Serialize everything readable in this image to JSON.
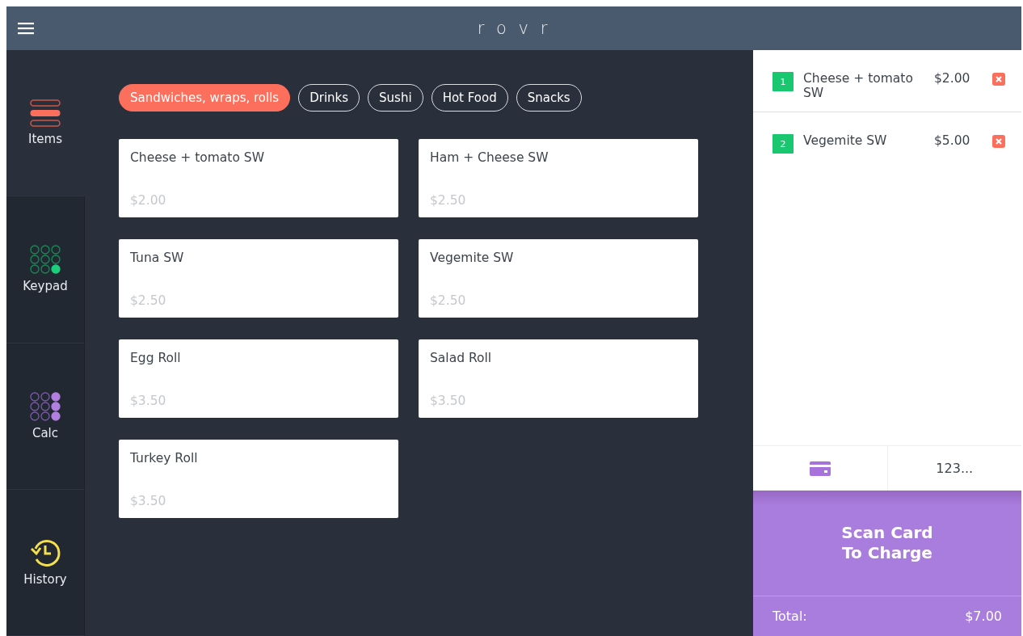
{
  "header": {
    "title": "r o v r"
  },
  "sidebar": {
    "items": [
      {
        "label": "Items",
        "kind": "items",
        "selected": true
      },
      {
        "label": "Keypad",
        "kind": "keypad",
        "selected": false
      },
      {
        "label": "Calc",
        "kind": "calc",
        "selected": false
      },
      {
        "label": "History",
        "kind": "history",
        "selected": false
      }
    ]
  },
  "categories": [
    {
      "label": "Sandwiches, wraps, rolls",
      "selected": true
    },
    {
      "label": "Drinks",
      "selected": false
    },
    {
      "label": "Sushi",
      "selected": false
    },
    {
      "label": "Hot Food",
      "selected": false
    },
    {
      "label": "Snacks",
      "selected": false
    }
  ],
  "products": [
    {
      "name": "Cheese + tomato SW",
      "price": "$2.00"
    },
    {
      "name": "Ham + Cheese SW",
      "price": "$2.50"
    },
    {
      "name": "Tuna SW",
      "price": "$2.50"
    },
    {
      "name": "Vegemite SW",
      "price": "$2.50"
    },
    {
      "name": "Egg Roll",
      "price": "$3.50"
    },
    {
      "name": "Salad Roll",
      "price": "$3.50"
    },
    {
      "name": "Turkey Roll",
      "price": "$3.50"
    }
  ],
  "order": {
    "lines": [
      {
        "qty": "1",
        "name": "Cheese + tomato SW",
        "price": "$2.00"
      },
      {
        "qty": "2",
        "name": "Vegemite SW",
        "price": "$5.00"
      }
    ],
    "payment_tabs": [
      {
        "kind": "card",
        "selected": true
      },
      {
        "kind": "text",
        "label": "123...",
        "selected": false
      }
    ],
    "charge_button": "Scan Card To Charge",
    "total_label": "Total:",
    "total": "$7.00"
  }
}
